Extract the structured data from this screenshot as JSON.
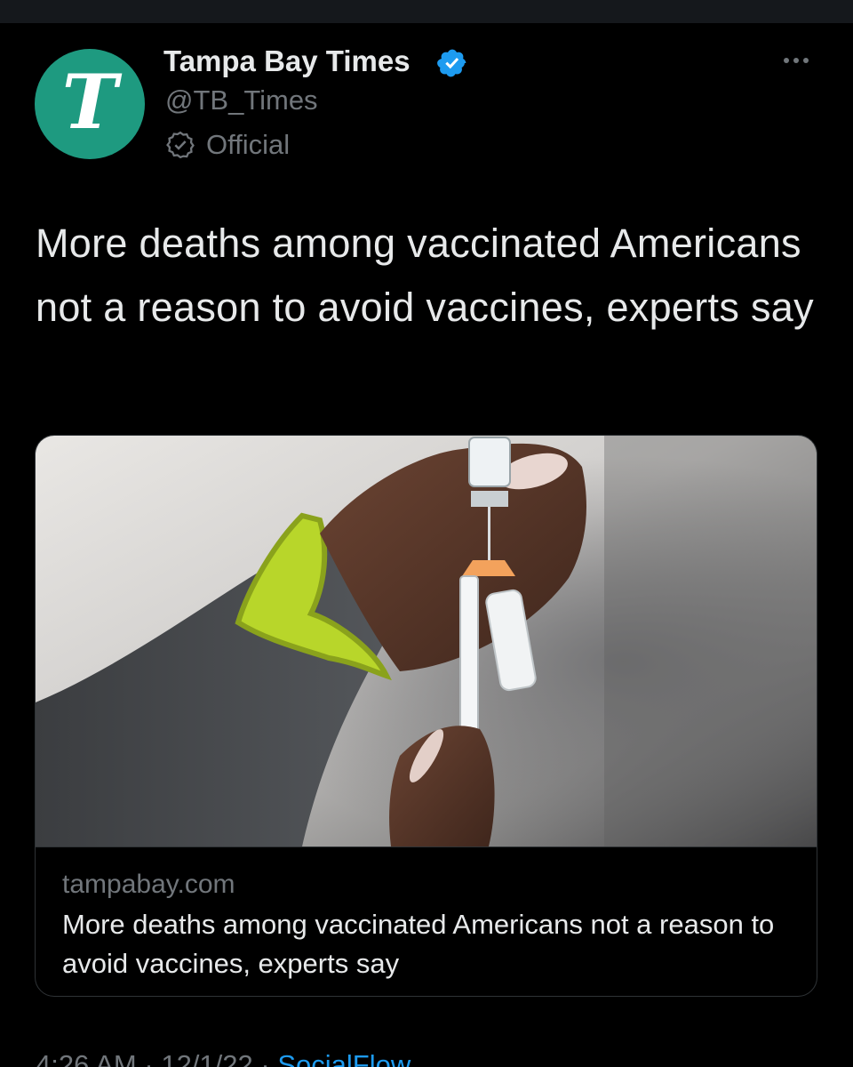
{
  "tweet": {
    "author": {
      "name": "Tampa Bay Times",
      "handle": "@TB_Times",
      "affiliation_label": "Official",
      "avatar_letter": "T"
    },
    "text": "More deaths among vaccinated Americans not a reason to avoid vaccines, experts say",
    "card": {
      "domain": "tampabay.com",
      "title": "More deaths among vaccinated Americans not a reason to avoid vaccines, experts say"
    },
    "meta": {
      "time": "4:26 AM",
      "date": "12/1/22",
      "separator": "·",
      "source": "SocialFlow"
    }
  },
  "colors": {
    "background": "#000000",
    "avatar_bg": "#1e9a80",
    "verified": "#1d9bf0",
    "muted_text": "#71767b",
    "primary_text": "#e7e9ea"
  },
  "icons": [
    "verified-badge-icon",
    "official-badge-icon",
    "more-options-icon",
    "photo-vaccine-syringe"
  ]
}
